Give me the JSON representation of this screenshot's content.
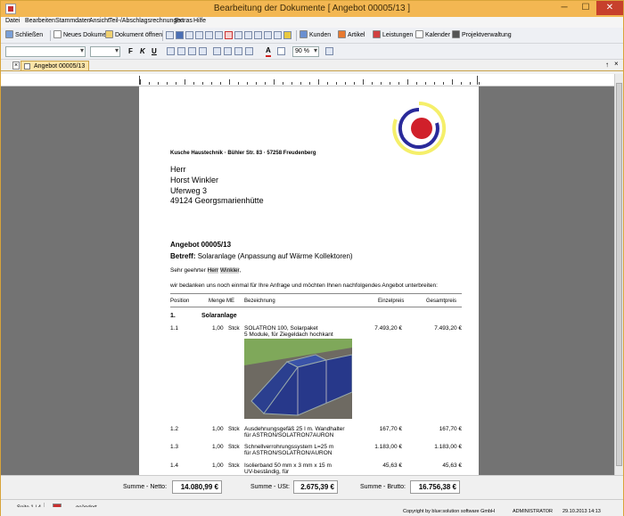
{
  "window": {
    "title": "Bearbeitung der Dokumente [ Angebot 00005/13 ]",
    "minimize_symbol": "─",
    "maximize_symbol": "☐",
    "close_symbol": "✕"
  },
  "menu": [
    "Datei",
    "Bearbeiten",
    "Stammdaten",
    "Ansicht",
    "Teil-/Abschlagsrechnungen",
    "Extras",
    "Hilfe"
  ],
  "toolbar": {
    "close_label": "Schließen",
    "new_doc_label": "Neues Dokument",
    "open_doc_label": "Dokument öffnen",
    "kunden_label": "Kunden",
    "artikel_label": "Artikel",
    "leistungen_label": "Leistungen",
    "kalender_label": "Kalender",
    "projekt_label": "Projektverwaltung"
  },
  "format_toolbar": {
    "bold": "F",
    "italic": "K",
    "underline": "U",
    "text_color": "A",
    "zoom": "90 %"
  },
  "tab": {
    "label": "Angebot 00005/13",
    "close_symbol": "×",
    "pin_symbol": "↑",
    "x_symbol": "×"
  },
  "document": {
    "sender_line": "Kusche Haustechnik · Bühler Str. 83 · 57258 Freudenberg",
    "recipient": [
      "Herr",
      "Horst Winkler",
      "Uferweg 3",
      "49124 Georgsmarienhütte"
    ],
    "doc_title": "Angebot 00005/13",
    "subject_label": "Betreff:",
    "subject_text": "Solaranlage (Anpassung auf Wärme Kollektoren)",
    "salutation_pre": "Sehr geehrter",
    "salutation_title": "Herr",
    "salutation_name": "Winkler",
    "salutation_post": ",",
    "intro": "wir bedanken uns noch einmal für Ihre Anfrage und möchten Ihnen nachfolgendes Angebot unterbreiten:",
    "columns": {
      "position": "Position",
      "menge_me": "Menge ME",
      "bezeichnung": "Bezeichnung",
      "einzelpreis": "Einzelpreis",
      "gesamtpreis": "Gesamtpreis"
    },
    "section": {
      "num": "1.",
      "title": "Solaranlage"
    },
    "items": [
      {
        "pos": "1.1",
        "menge": "1,00",
        "me": "Stck",
        "line1": "SOLATRON 100, Solarpaket",
        "line2": "5 Module, für Ziegeldach hochkant",
        "einzel": "7.493,20 €",
        "gesamt": "7.493,20 €"
      },
      {
        "pos": "1.2",
        "menge": "1,00",
        "me": "Stck",
        "line1": "Ausdehnungsgefäß 25 l m. Wandhalter",
        "line2": "für ASTRON/SOLATRON7AURON",
        "einzel": "167,70 €",
        "gesamt": "167,70 €"
      },
      {
        "pos": "1.3",
        "menge": "1,00",
        "me": "Stck",
        "line1": "Schnellverrohrungssystem L=25 m",
        "line2": "für ASTRON/SOLATRON/AURON",
        "einzel": "1.183,00 €",
        "gesamt": "1.183,00 €"
      },
      {
        "pos": "1.4",
        "menge": "1,00",
        "me": "Stck",
        "line1": "Isolierband 50 mm x 3 mm x 15 m",
        "line2": "UV-beständig, für",
        "einzel": "45,63 €",
        "gesamt": "45,63 €"
      }
    ]
  },
  "totals": {
    "netto_label": "Summe - Netto:",
    "netto_value": "14.080,99 €",
    "ust_label": "Summe - USt:",
    "ust_value": "2.675,39 €",
    "brutto_label": "Summe - Brutto:",
    "brutto_value": "16.756,38 €"
  },
  "status": {
    "page": "Seite 1 / 4",
    "changed": "geändert",
    "copyright": "Copyright by blue:solution software GmbH",
    "user": "ADMINISTRATOR",
    "datetime": "29.10.2013 14:13"
  },
  "colors": {
    "titlebar": "#f3b752",
    "close_button": "#c7402c",
    "workspace": "#737373",
    "logo_red": "#d0202a",
    "logo_blue": "#2a2a9a",
    "logo_yellow": "#f5ef6a"
  }
}
